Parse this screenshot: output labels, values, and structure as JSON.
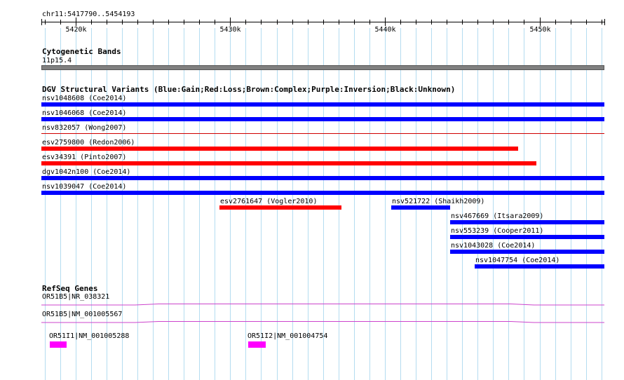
{
  "ruler": {
    "position_label": "chr11:5417790..5454193",
    "start": 5417790,
    "end": 5454193,
    "ticks": [
      {
        "pos": 5420000,
        "label": "5420k"
      },
      {
        "pos": 5430000,
        "label": "5430k"
      },
      {
        "pos": 5440000,
        "label": "5440k"
      },
      {
        "pos": 5450000,
        "label": "5450k"
      }
    ]
  },
  "tracks": {
    "cytoband": {
      "title": "Cytogenetic Bands",
      "band_label": "11p15.4",
      "color": "#808080"
    },
    "dgv": {
      "title": "DGV Structural Variants (Blue:Gain;Red:Loss;Brown:Complex;Purple:Inversion;Black:Unknown)",
      "variants": [
        {
          "label": "nsv1048608 (Coe2014)",
          "start": 5417790,
          "end": 5454193,
          "color": "#0000ff",
          "row": 0
        },
        {
          "label": "nsv1046068 (Coe2014)",
          "start": 5417790,
          "end": 5454193,
          "color": "#0000ff",
          "row": 1
        },
        {
          "label": "nsv832057 (Wong2007)",
          "start": 5417790,
          "end": 5454193,
          "color": "#d00000",
          "row": 2,
          "thin": true
        },
        {
          "label": "esv2759800 (Redon2006)",
          "start": 5417790,
          "end": 5448600,
          "color": "#ff0000",
          "row": 3
        },
        {
          "label": "esv34391 (Pinto2007)",
          "start": 5417790,
          "end": 5449800,
          "color": "#ff0000",
          "row": 4
        },
        {
          "label": "dgv1042n100 (Coe2014)",
          "start": 5417790,
          "end": 5454193,
          "color": "#0000ff",
          "row": 5
        },
        {
          "label": "nsv1039047 (Coe2014)",
          "start": 5417790,
          "end": 5454193,
          "color": "#0000ff",
          "row": 6
        },
        {
          "label": "esv2761647 (Vogler2010)",
          "start": 5429300,
          "end": 5437200,
          "color": "#ff0000",
          "row": 7
        },
        {
          "label": "nsv521722 (Shaikh2009)",
          "start": 5440400,
          "end": 5444200,
          "color": "#0000ff",
          "row": 7
        },
        {
          "label": "nsv467669 (Itsara2009)",
          "start": 5444200,
          "end": 5454193,
          "color": "#0000ff",
          "row": 8
        },
        {
          "label": "nsv553239 (Cooper2011)",
          "start": 5444200,
          "end": 5454193,
          "color": "#0000ff",
          "row": 9
        },
        {
          "label": "nsv1043028 (Coe2014)",
          "start": 5444200,
          "end": 5454193,
          "color": "#0000ff",
          "row": 10
        },
        {
          "label": "nsv1047754 (Coe2014)",
          "start": 5445800,
          "end": 5454193,
          "color": "#0000ff",
          "row": 11
        }
      ]
    },
    "refseq": {
      "title": "RefSeq Genes",
      "genes": [
        {
          "label": "OR51B5|NR_038321",
          "start": 5417790,
          "end": 5454193,
          "color": "#cc44cc",
          "type": "transcript",
          "row": 0
        },
        {
          "label": "OR51B5|NM_001005567",
          "start": 5417790,
          "end": 5454193,
          "color": "#cc44cc",
          "type": "transcript",
          "row": 1
        },
        {
          "label": "OR51I1|NM_001005288",
          "start": 5418340,
          "end": 5419420,
          "color": "#ff00ff",
          "type": "exon",
          "row": 2
        },
        {
          "label": "OR51I2|NM_001004754",
          "start": 5431180,
          "end": 5432290,
          "color": "#ff00ff",
          "type": "exon",
          "row": 2
        }
      ]
    }
  },
  "colors": {
    "gridline": "#b4dcf0",
    "gain": "#0000ff",
    "loss": "#ff0000"
  }
}
